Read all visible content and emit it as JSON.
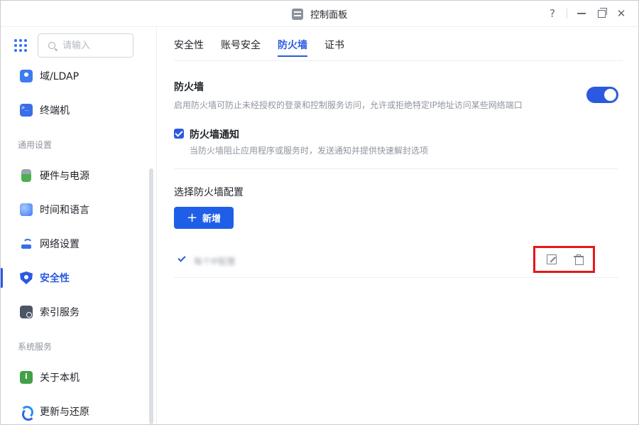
{
  "window": {
    "title": "控制面板",
    "help_label": "?"
  },
  "search": {
    "placeholder": "请输入"
  },
  "sidebar": {
    "items": [
      {
        "label": "域/LDAP",
        "icon": "domain-ldap-icon"
      },
      {
        "label": "终端机",
        "icon": "terminal-icon"
      },
      {
        "label": "硬件与电源",
        "icon": "hardware-power-icon"
      },
      {
        "label": "时间和语言",
        "icon": "time-language-icon"
      },
      {
        "label": "网络设置",
        "icon": "network-icon"
      },
      {
        "label": "安全性",
        "icon": "security-shield-icon",
        "active": true
      },
      {
        "label": "索引服务",
        "icon": "index-service-icon"
      },
      {
        "label": "关于本机",
        "icon": "info-icon"
      },
      {
        "label": "更新与还原",
        "icon": "update-icon"
      }
    ],
    "sections": {
      "general": "通用设置",
      "system": "系统服务"
    }
  },
  "tabs": [
    {
      "label": "安全性"
    },
    {
      "label": "账号安全"
    },
    {
      "label": "防火墙",
      "active": true
    },
    {
      "label": "证书"
    }
  ],
  "firewall": {
    "title": "防火墙",
    "description": "启用防火墙可防止未经授权的登录和控制服务访问，允许或拒绝特定IP地址访问某些网络端口",
    "enabled": true
  },
  "notification": {
    "label": "防火墙通知",
    "description": "当防火墙阻止应用程序或服务时，发送通知并提供快速解封选项",
    "checked": true
  },
  "config": {
    "title": "选择防火墙配置",
    "add_label": "新增",
    "profiles": [
      {
        "name": "每个IP配置",
        "selected": true
      }
    ]
  },
  "colors": {
    "accent": "#2b5ae0",
    "highlight": "#e8171b"
  }
}
